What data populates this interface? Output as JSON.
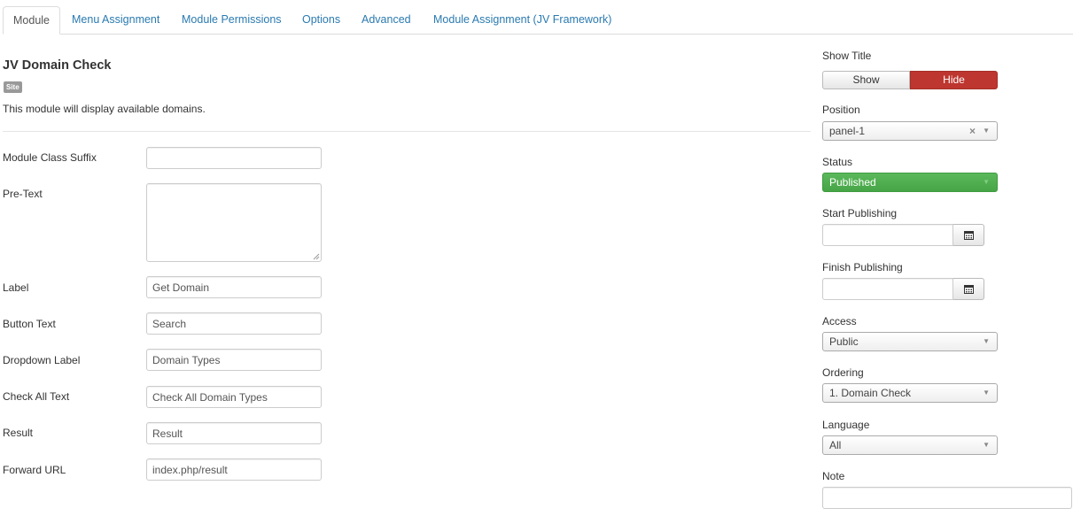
{
  "tabs": [
    {
      "label": "Module",
      "active": true
    },
    {
      "label": "Menu Assignment",
      "active": false
    },
    {
      "label": "Module Permissions",
      "active": false
    },
    {
      "label": "Options",
      "active": false
    },
    {
      "label": "Advanced",
      "active": false
    },
    {
      "label": "Module Assignment (JV Framework)",
      "active": false
    }
  ],
  "module": {
    "title": "JV Domain Check",
    "badge": "Site",
    "description": "This module will display available domains."
  },
  "form": {
    "module_class_suffix": {
      "label": "Module Class Suffix",
      "value": ""
    },
    "pre_text": {
      "label": "Pre-Text",
      "value": ""
    },
    "label": {
      "label": "Label",
      "value": "Get Domain"
    },
    "button_text": {
      "label": "Button Text",
      "value": "Search"
    },
    "dropdown_label": {
      "label": "Dropdown Label",
      "value": "Domain Types"
    },
    "check_all_text": {
      "label": "Check All Text",
      "value": "Check All Domain Types"
    },
    "result": {
      "label": "Result",
      "value": "Result"
    },
    "forward_url": {
      "label": "Forward URL",
      "value": "index.php/result"
    }
  },
  "sidebar": {
    "show_title": {
      "label": "Show Title",
      "show": "Show",
      "hide": "Hide",
      "selected": "Hide"
    },
    "position": {
      "label": "Position",
      "value": "panel-1"
    },
    "status": {
      "label": "Status",
      "value": "Published"
    },
    "start_publishing": {
      "label": "Start Publishing",
      "value": ""
    },
    "finish_publishing": {
      "label": "Finish Publishing",
      "value": ""
    },
    "access": {
      "label": "Access",
      "value": "Public"
    },
    "ordering": {
      "label": "Ordering",
      "value": "1. Domain Check"
    },
    "language": {
      "label": "Language",
      "value": "All"
    },
    "note": {
      "label": "Note",
      "value": ""
    }
  },
  "colors": {
    "link": "#2a7ab0",
    "hide_active": "#bd362f",
    "published": "#46a546",
    "badge": "#999999"
  },
  "icons": {
    "calendar": "calendar-icon",
    "clear": "clear-x-icon",
    "dropdown": "caret-down-icon"
  }
}
